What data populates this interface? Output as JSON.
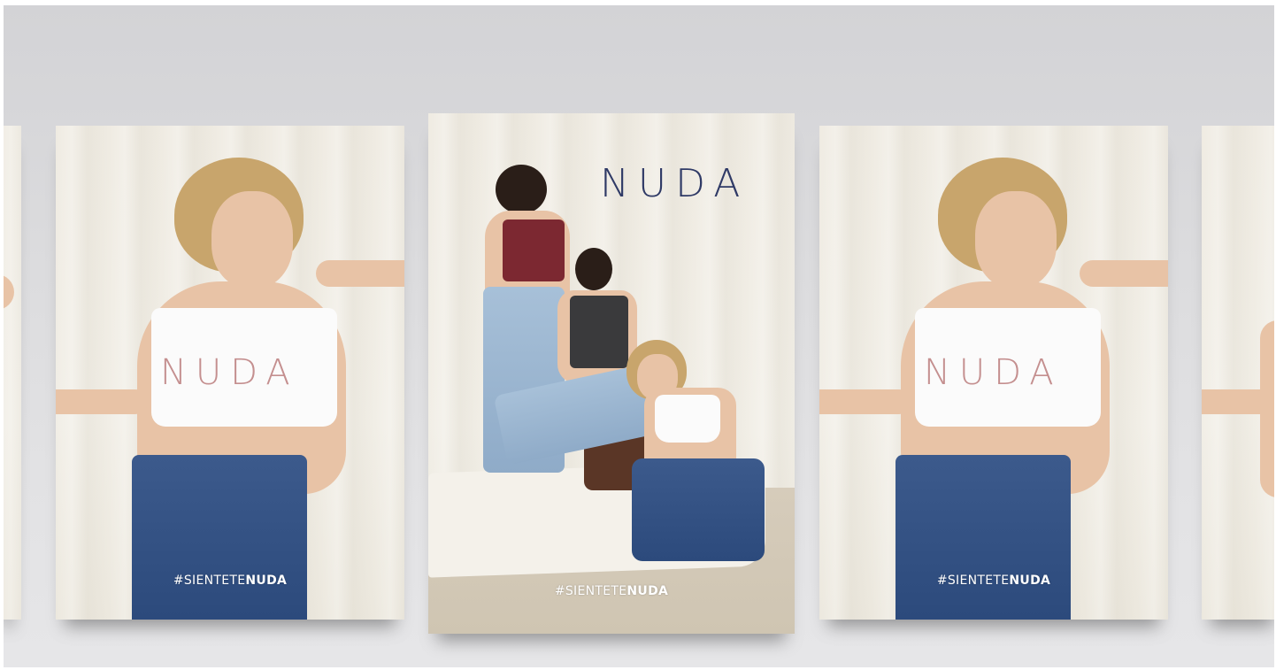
{
  "hashtag": {
    "prefix": "#SIENTETE",
    "brand": "NUDA"
  },
  "logo": {
    "text": "NUDA",
    "print_color": "#c48f8f",
    "header_color": "#2f3a66"
  },
  "posters": [
    {
      "id": "left-partial"
    },
    {
      "id": "left"
    },
    {
      "id": "center"
    },
    {
      "id": "right"
    },
    {
      "id": "right-partial"
    }
  ]
}
